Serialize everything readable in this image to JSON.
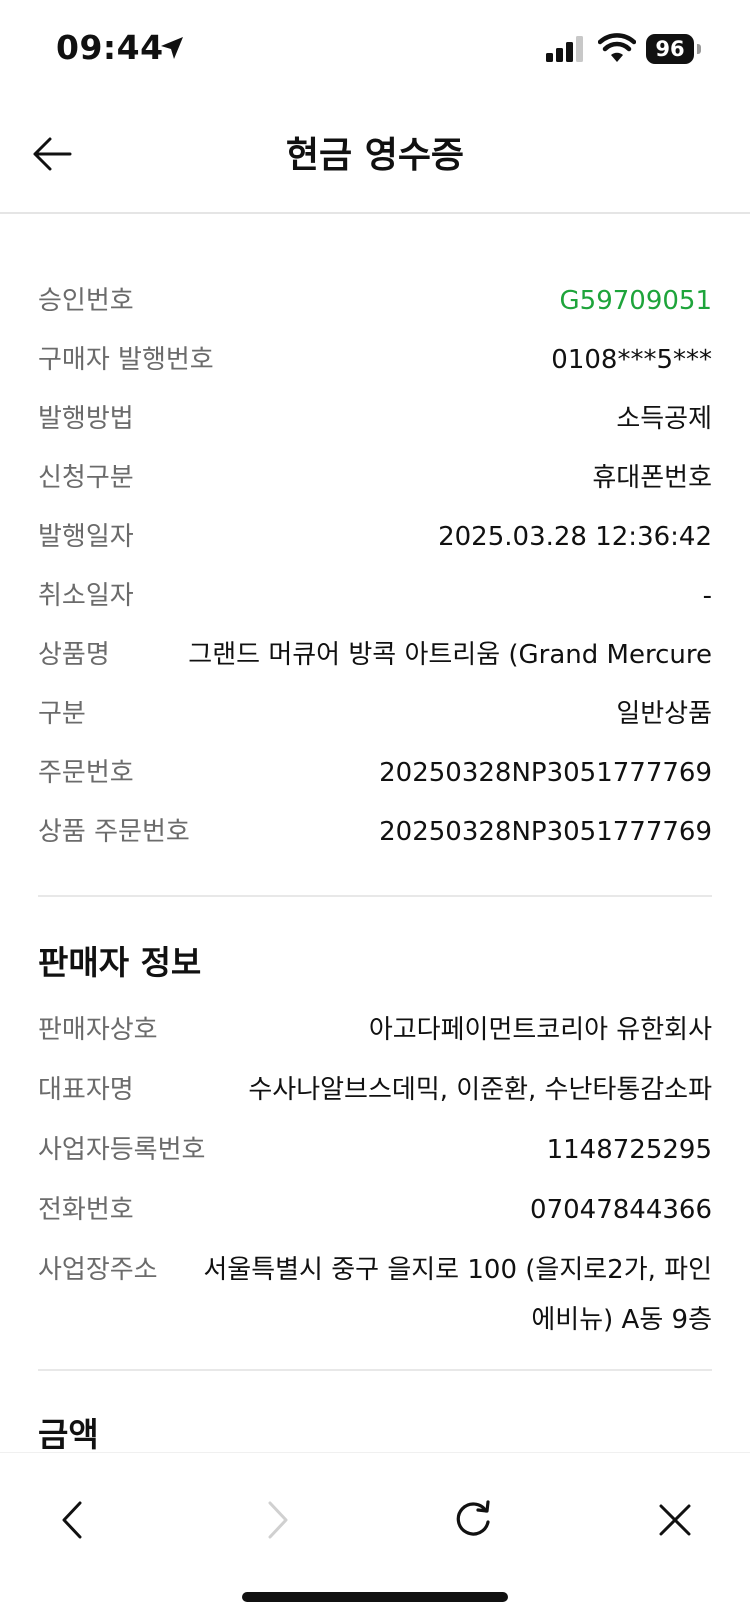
{
  "status_bar": {
    "time": "09:44",
    "battery": "96"
  },
  "header": {
    "title": "현금 영수증"
  },
  "receipt": [
    {
      "label": "승인번호",
      "value": "G59709051"
    },
    {
      "label": "구매자 발행번호",
      "value": "0108***5***"
    },
    {
      "label": "발행방법",
      "value": "소득공제"
    },
    {
      "label": "신청구분",
      "value": "휴대폰번호"
    },
    {
      "label": "발행일자",
      "value": "2025.03.28 12:36:42"
    },
    {
      "label": "취소일자",
      "value": "-"
    },
    {
      "label": "상품명",
      "value": "그랜드 머큐어 방콕 아트리움 (Grand Mercure"
    },
    {
      "label": "구분",
      "value": "일반상품"
    },
    {
      "label": "주문번호",
      "value": "20250328NP3051777769"
    },
    {
      "label": "상품 주문번호",
      "value": "20250328NP3051777769"
    }
  ],
  "seller": {
    "title": "판매자 정보",
    "rows": [
      {
        "label": "판매자상호",
        "value": "아고다페이먼트코리아 유한회사"
      },
      {
        "label": "대표자명",
        "value": "수사나알브스데믹, 이준환, 수난타통감소파"
      },
      {
        "label": "사업자등록번호",
        "value": "1148725295"
      },
      {
        "label": "전화번호",
        "value": "07047844366"
      },
      {
        "label": "사업장주소",
        "value": "서울특별시 중구 을지로 100 (을지로2가, 파인 에비뉴) A동 9층"
      }
    ]
  },
  "amount": {
    "title": "금액"
  },
  "colors": {
    "accent_green": "#1ea43b",
    "label_gray": "#6b6b6b"
  }
}
